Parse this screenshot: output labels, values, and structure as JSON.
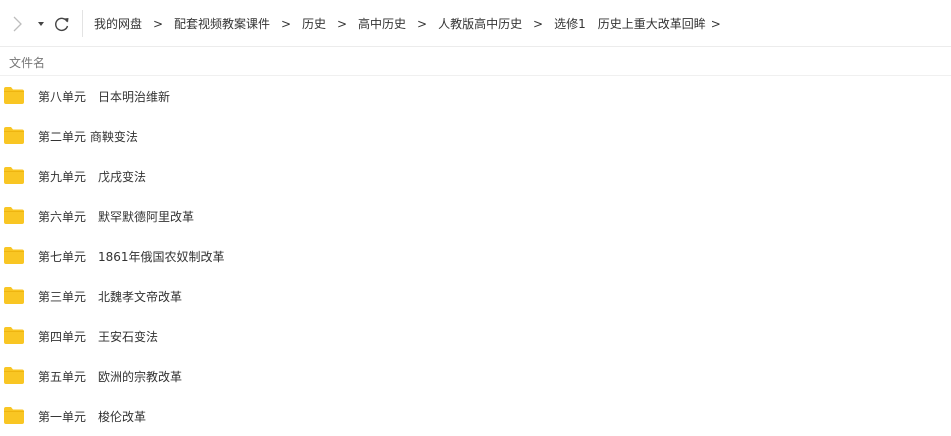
{
  "toolbar": {
    "forward_icon": "chevron-right-icon",
    "dropdown_icon": "caret-down-icon",
    "refresh_icon": "refresh-icon"
  },
  "breadcrumb": {
    "items": [
      "我的网盘",
      "配套视频教案课件",
      "历史",
      "高中历史",
      "人教版高中历史",
      "选修1　历史上重大改革回眸"
    ],
    "separator": ">"
  },
  "columns": {
    "name": "文件名"
  },
  "files": [
    {
      "name": "第八单元　日本明治维新",
      "type": "folder"
    },
    {
      "name": "第二单元 商鞅变法",
      "type": "folder"
    },
    {
      "name": "第九单元　戊戌变法",
      "type": "folder"
    },
    {
      "name": "第六单元　默罕默德阿里改革",
      "type": "folder"
    },
    {
      "name": "第七单元　1861年俄国农奴制改革",
      "type": "folder"
    },
    {
      "name": "第三单元　北魏孝文帝改革",
      "type": "folder"
    },
    {
      "name": "第四单元　王安石变法",
      "type": "folder"
    },
    {
      "name": "第五单元　欧洲的宗教改革",
      "type": "folder"
    },
    {
      "name": "第一单元　梭伦改革",
      "type": "folder"
    }
  ],
  "colors": {
    "folder": "#F9C623",
    "folder_dark": "#EFB511",
    "text": "#333333",
    "icon": "#666666"
  }
}
